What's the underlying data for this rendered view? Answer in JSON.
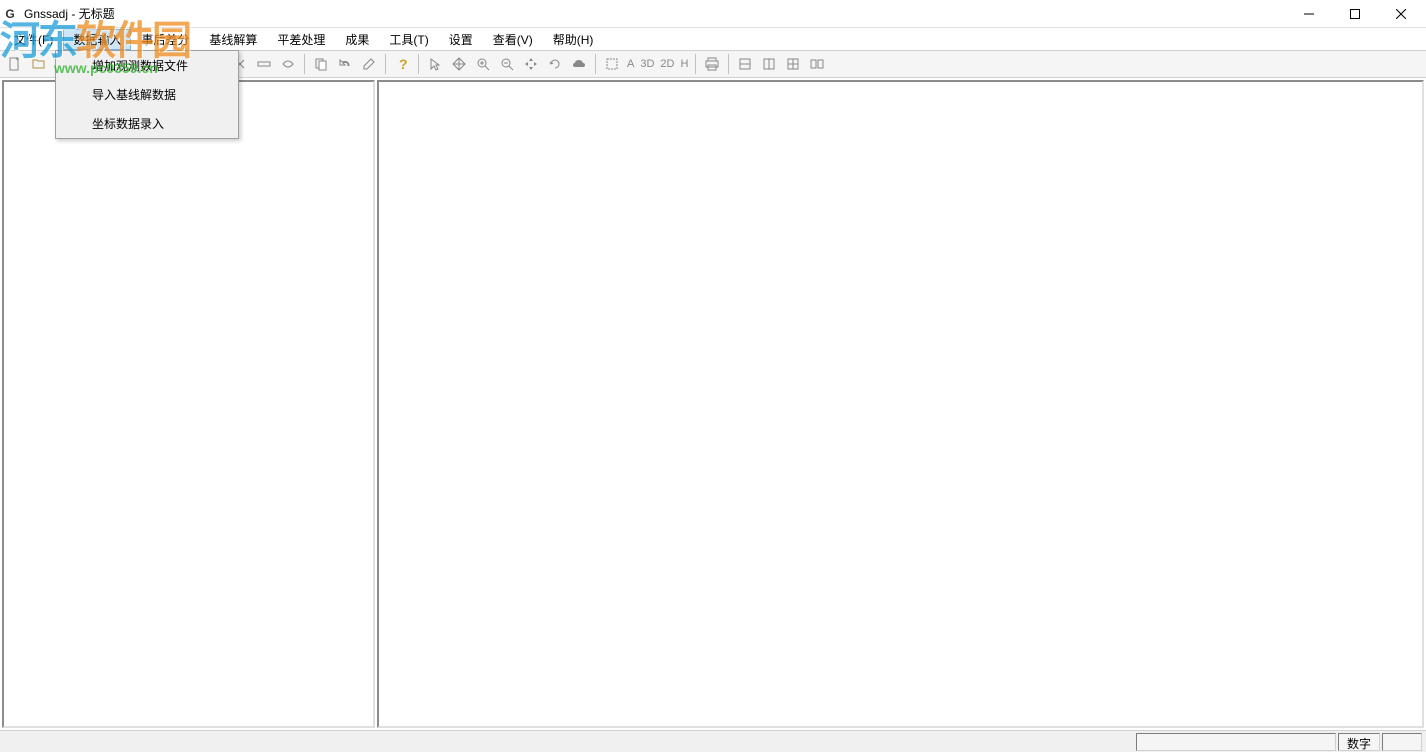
{
  "title_bar": {
    "app_icon_text": "G",
    "title": "Gnssadj - 无标题"
  },
  "menu": {
    "items": [
      {
        "label": "文件(F)"
      },
      {
        "label": "数据输入"
      },
      {
        "label": "事后差分"
      },
      {
        "label": "基线解算"
      },
      {
        "label": "平差处理"
      },
      {
        "label": "成果"
      },
      {
        "label": "工具(T)"
      },
      {
        "label": "设置"
      },
      {
        "label": "查看(V)"
      },
      {
        "label": "帮助(H)"
      }
    ]
  },
  "dropdown": {
    "items": [
      {
        "label": "增加观测数据文件"
      },
      {
        "label": "导入基线解数据"
      },
      {
        "label": "坐标数据录入"
      }
    ]
  },
  "toolbar": {
    "text_3d": "3D",
    "text_2d": "2D",
    "text_h": "H",
    "text_a": "A"
  },
  "status_bar": {
    "label_numlock": "数字"
  },
  "watermark": {
    "logo_part1": "河东",
    "logo_part2": "软件园",
    "url": "www.pc0359.cn"
  }
}
